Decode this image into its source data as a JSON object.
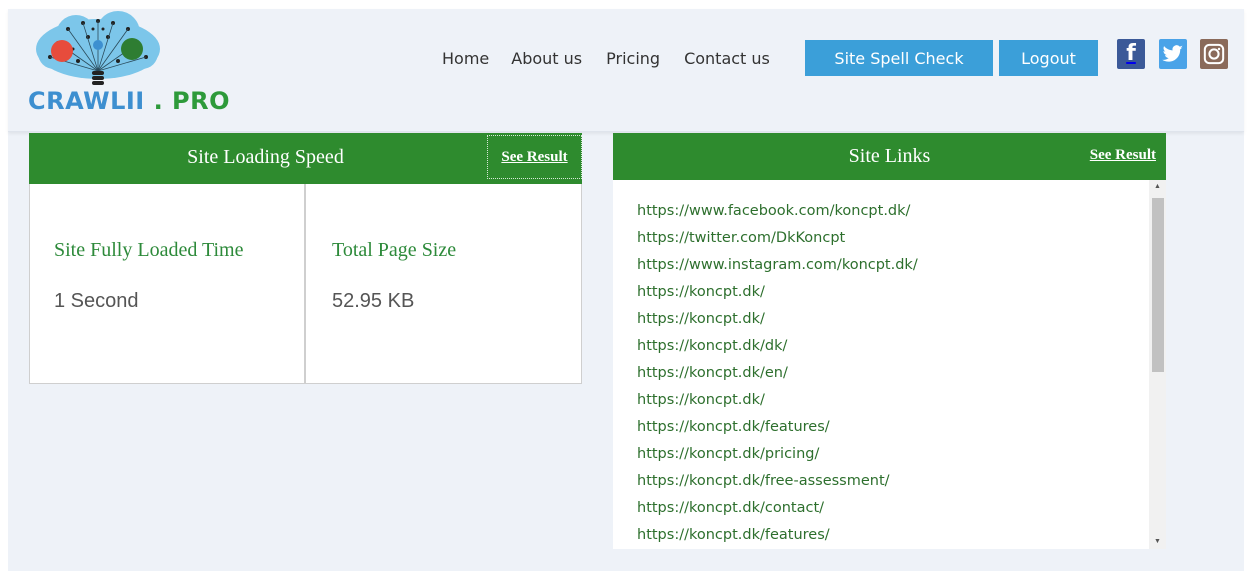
{
  "brand": {
    "part1": "CRAWLII",
    "part2": ". PRO",
    "color1": "#3d8fd0",
    "color2": "#2d9a3a"
  },
  "nav": {
    "items": [
      "Home",
      "About us",
      "Pricing",
      "Contact us"
    ],
    "spell_check_label": "Site Spell Check",
    "logout_label": "Logout",
    "button_color": "#3b9fd9"
  },
  "social": [
    {
      "icon": "facebook-icon",
      "glyph": "f",
      "color": "#3b5998"
    },
    {
      "icon": "twitter-icon",
      "color": "#4aa3e8"
    },
    {
      "icon": "instagram-icon",
      "color": "#8a6a5a"
    }
  ],
  "speed": {
    "title": "Site Loading Speed",
    "see_result": "See Result",
    "metrics": [
      {
        "label": "Site Fully Loaded Time",
        "value": "1 Second"
      },
      {
        "label": "Total Page Size",
        "value": "52.95 KB"
      }
    ]
  },
  "links": {
    "title": "Site Links",
    "see_result": "See Result",
    "items": [
      "https://www.facebook.com/koncpt.dk/",
      "https://twitter.com/DkKoncpt",
      "https://www.instagram.com/koncpt.dk/",
      "https://koncpt.dk/",
      "https://koncpt.dk/",
      "https://koncpt.dk/dk/",
      "https://koncpt.dk/en/",
      "https://koncpt.dk/",
      "https://koncpt.dk/features/",
      "https://koncpt.dk/pricing/",
      "https://koncpt.dk/free-assessment/",
      "https://koncpt.dk/contact/",
      "https://koncpt.dk/features/"
    ]
  },
  "theme": {
    "header_green": "#2e8b2e",
    "page_bg": "#eef2f8"
  }
}
